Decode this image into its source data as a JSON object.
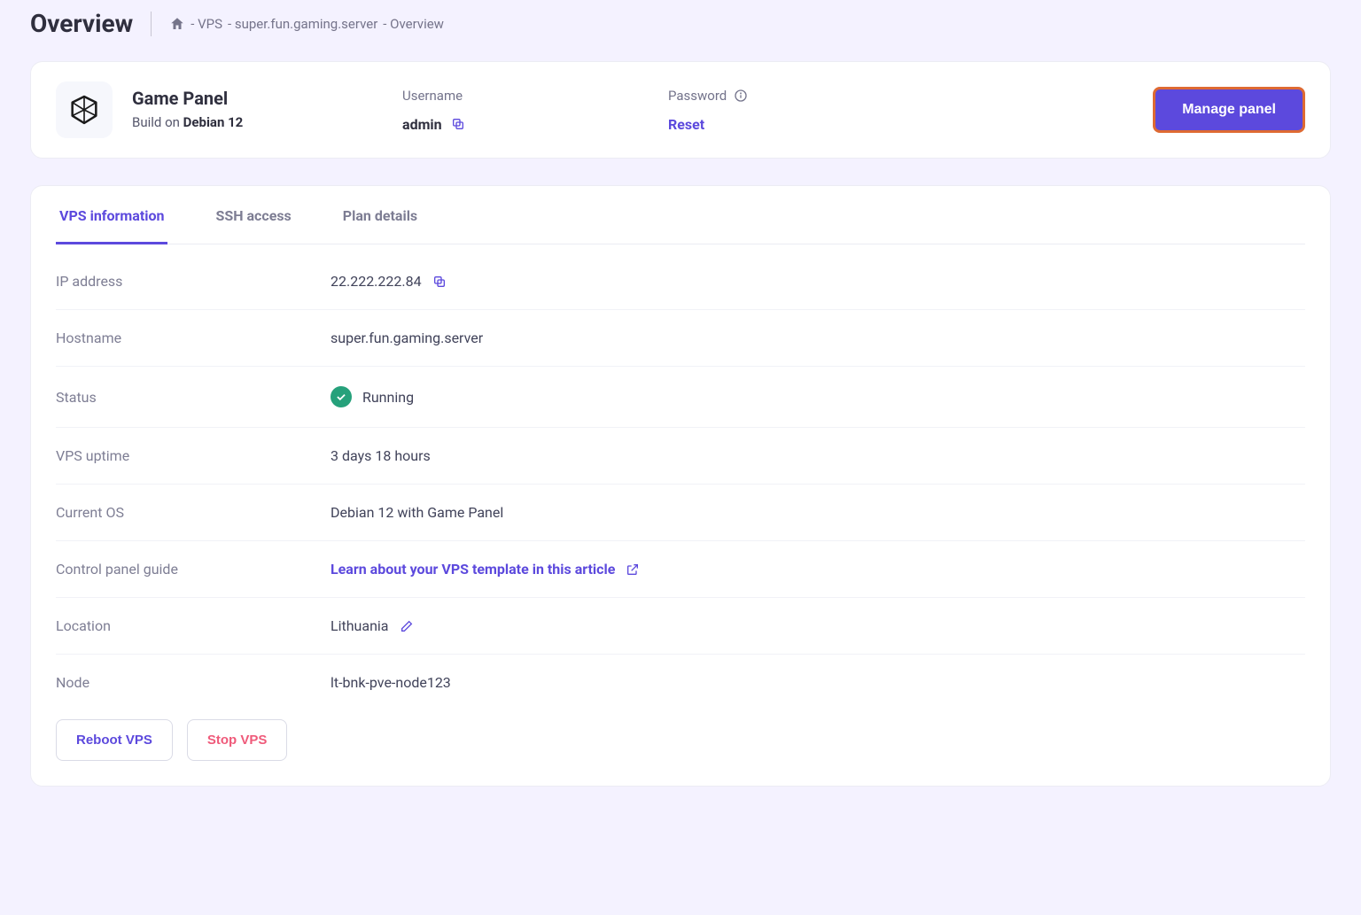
{
  "page": {
    "title": "Overview"
  },
  "breadcrumb": {
    "sep1": "- VPS",
    "sep2": "- super.fun.gaming.server",
    "sep3": "- Overview"
  },
  "panel": {
    "name": "Game Panel",
    "build_prefix": "Build on ",
    "build_value": "Debian 12",
    "username_label": "Username",
    "username": "admin",
    "password_label": "Password",
    "reset": "Reset",
    "manage_btn": "Manage panel"
  },
  "tabs": {
    "vps_info": "VPS information",
    "ssh": "SSH access",
    "plan": "Plan details"
  },
  "info": {
    "ip_label": "IP address",
    "ip": "22.222.222.84",
    "hostname_label": "Hostname",
    "hostname": "super.fun.gaming.server",
    "status_label": "Status",
    "status": "Running",
    "uptime_label": "VPS uptime",
    "uptime": "3 days 18 hours",
    "os_label": "Current OS",
    "os": "Debian 12 with Game Panel",
    "guide_label": "Control panel guide",
    "guide_link": "Learn about your VPS template in this article",
    "location_label": "Location",
    "location": "Lithuania",
    "node_label": "Node",
    "node": "lt-bnk-pve-node123"
  },
  "actions": {
    "reboot": "Reboot VPS",
    "stop": "Stop VPS"
  }
}
